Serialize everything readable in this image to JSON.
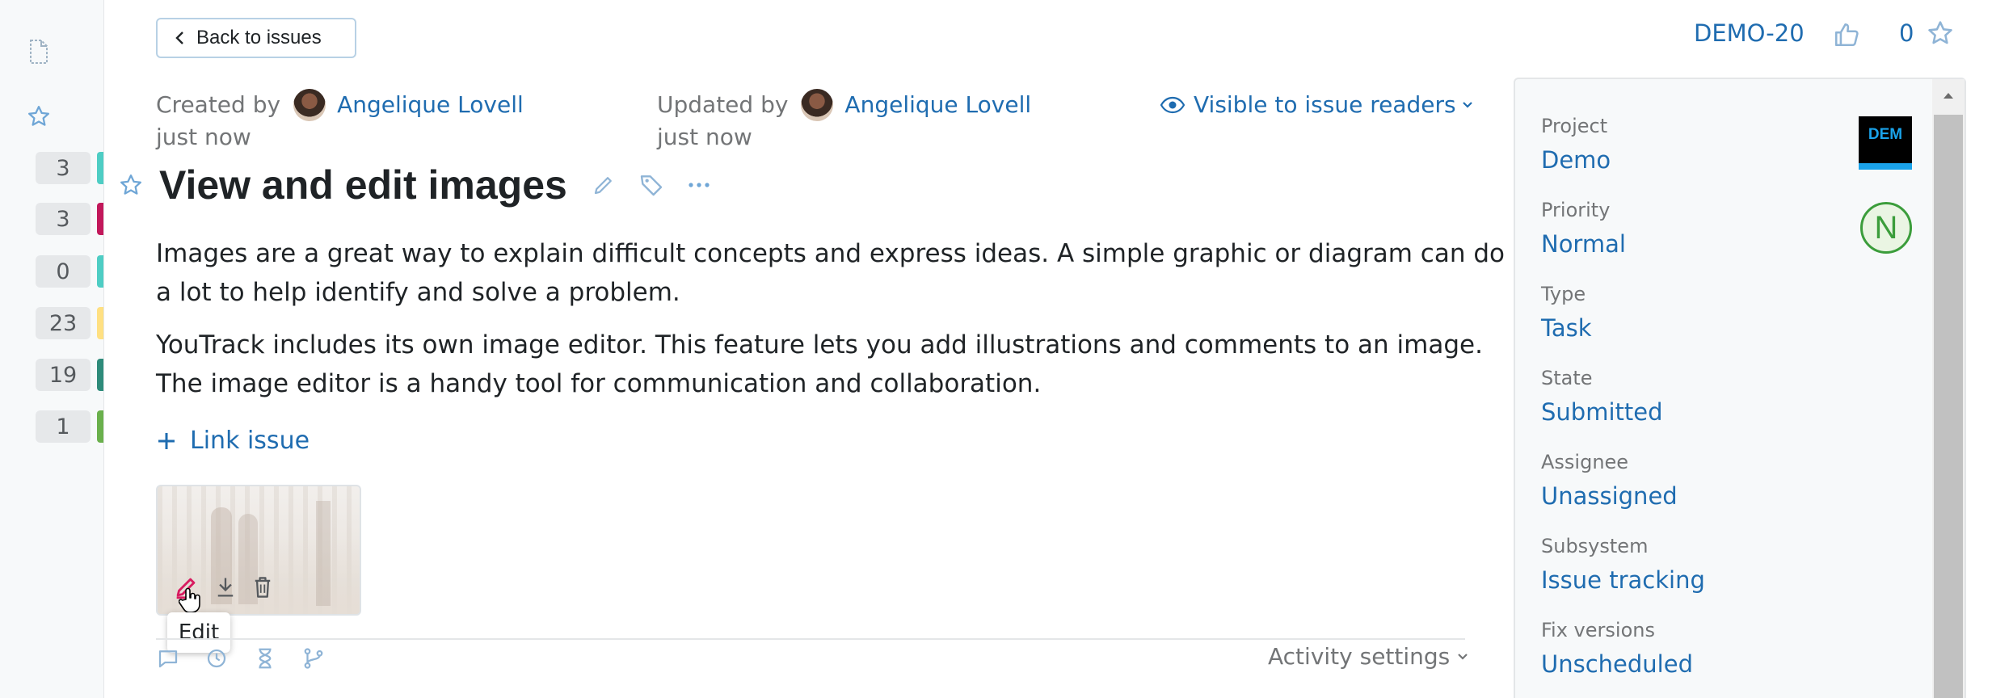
{
  "sidebar": {
    "counters": [
      {
        "value": "3",
        "color": "#4ecdc4"
      },
      {
        "value": "3",
        "color": "#c2185b"
      },
      {
        "value": "0",
        "color": "#4ecdc4"
      },
      {
        "value": "23",
        "color": "#ffe082"
      },
      {
        "value": "19",
        "color": "#2e8b7a"
      },
      {
        "value": "1",
        "color": "#6ab04c"
      }
    ]
  },
  "header": {
    "back_label": "Back to issues",
    "issue_id": "DEMO-20",
    "vote_count": "0"
  },
  "meta": {
    "created_label": "Created by",
    "created_user": "Angelique Lovell",
    "created_time": "just now",
    "updated_label": "Updated by",
    "updated_user": "Angelique Lovell",
    "updated_time": "just now",
    "visibility": "Visible to issue readers"
  },
  "issue": {
    "title": "View and edit images",
    "paragraph1": "Images are a great way to explain difficult concepts and express ideas. A simple graphic or diagram can do a lot to help identify and solve a problem.",
    "paragraph2": "YouTrack includes its own image editor. This feature lets you add illustrations and comments to an image. The image editor is a handy tool for communication and collaboration.",
    "link_issue": "Link issue"
  },
  "attachment": {
    "tooltip": "Edit"
  },
  "activity": {
    "settings_label": "Activity settings"
  },
  "fields": {
    "project": {
      "label": "Project",
      "value": "Demo",
      "logo_text": "DEM"
    },
    "priority": {
      "label": "Priority",
      "value": "Normal",
      "badge": "N"
    },
    "type": {
      "label": "Type",
      "value": "Task"
    },
    "state": {
      "label": "State",
      "value": "Submitted"
    },
    "assignee": {
      "label": "Assignee",
      "value": "Unassigned"
    },
    "subsystem": {
      "label": "Subsystem",
      "value": "Issue tracking"
    },
    "fix_versions": {
      "label": "Fix versions",
      "value": "Unscheduled"
    }
  },
  "colors": {
    "link": "#1f6cb0",
    "accent_edit": "#d81b60",
    "priority_green": "#3b9d3b",
    "project_blue": "#1aa3ea"
  }
}
